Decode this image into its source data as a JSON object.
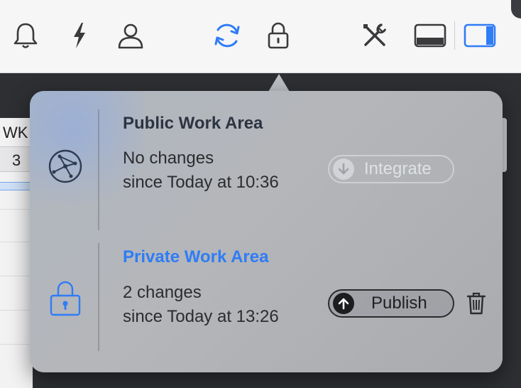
{
  "background": {
    "week_header": "WK",
    "week_number": "3"
  },
  "public": {
    "title": "Public Work Area",
    "changes": "No changes",
    "since": "since Today at 10:36",
    "button": "Integrate"
  },
  "private": {
    "title": "Private Work Area",
    "changes": "2 changes",
    "since": "since Today at 13:26",
    "button": "Publish"
  },
  "colors": {
    "accent": "#2f7cf6",
    "toolbar_icon": "#3a3a3c"
  },
  "icons": [
    "bell-icon",
    "bolt-icon",
    "person-icon",
    "sync-icon",
    "lock-icon",
    "tools-icon",
    "bottom-panel-icon",
    "right-panel-icon",
    "network-icon",
    "trash-icon"
  ]
}
